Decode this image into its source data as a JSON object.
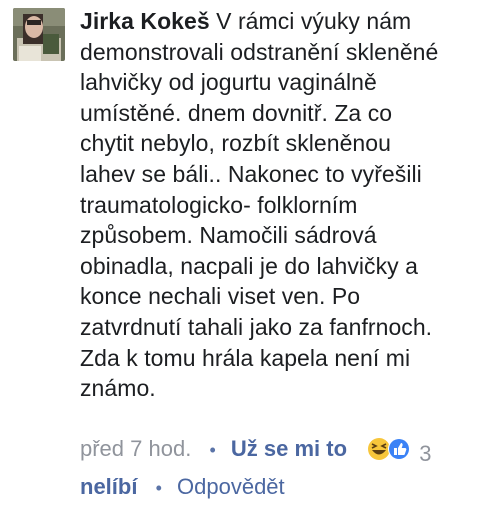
{
  "comment": {
    "author": "Jirka Kokeš",
    "lines": [
      " V rámci výuky nám",
      "demonstrovali odstranění skleněné",
      "lahvičky od jogurtu vaginálně",
      "umístěné. dnem dovnitř. Za co",
      "chytit nebylo, rozbít skleněnou",
      "lahev se báli.. Nakonec to vyřešili",
      "traumatologicko- folklorním",
      "způsobem. Namočili sádrová",
      "obinadla, nacpali je do lahvičky a",
      "konce nechali viset ven. Po",
      "zatvrdnutí tahali jako za fanfrnoch.",
      "Zda k tomu hrála kapela není mi",
      "známo."
    ]
  },
  "meta": {
    "time": "před 7 hod.",
    "separator": "•",
    "like_label_1": "Už se mi to",
    "like_label_2": "nelíbí",
    "reaction_count": "3",
    "reply_label": "Odpovědět"
  },
  "icons": {
    "avatar": "avatar-photo",
    "reaction_haha": "haha-emoji-icon",
    "reaction_like": "like-thumb-icon"
  },
  "colors": {
    "link": "#4b67a1",
    "muted": "#90949c",
    "text": "#1c1e21"
  }
}
